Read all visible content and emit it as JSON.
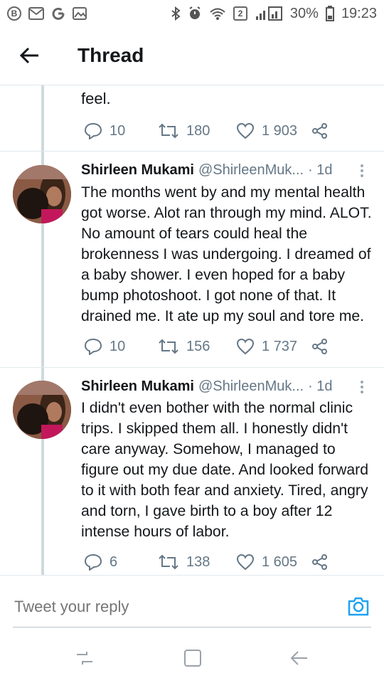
{
  "status_bar": {
    "left_icons": [
      "b-icon",
      "gmail-icon",
      "google-icon",
      "gallery-icon"
    ],
    "b_label": "B",
    "sim_slot": "2",
    "battery": "30%",
    "time": "19:23"
  },
  "header": {
    "title": "Thread"
  },
  "previous_tweet": {
    "text_fragment": "feel.",
    "replies": "10",
    "retweets": "180",
    "likes": "1 903"
  },
  "tweets": [
    {
      "name": "Shirleen Mukami",
      "handle": "@ShirleenMuk...",
      "time": "· 1d",
      "text": "The months went by and my mental health got worse. Alot ran through my mind. ALOT. No amount of tears could heal the brokenness I was undergoing. I dreamed of a baby shower. I even hoped for a baby bump photoshoot. I got none of that. It drained me. It ate up my soul and tore me.",
      "replies": "10",
      "retweets": "156",
      "likes": "1 737"
    },
    {
      "name": "Shirleen Mukami",
      "handle": "@ShirleenMuk...",
      "time": "· 1d",
      "text": "I didn't even bother with the normal clinic trips. I skipped them all. I honestly didn't care anyway. Somehow, I managed to figure out my due date. And looked forward to it with both fear and anxiety. Tired, angry and torn, I gave birth to a boy after 12 intense hours of labor.",
      "replies": "6",
      "retweets": "138",
      "likes": "1 605"
    }
  ],
  "reply": {
    "placeholder": "Tweet your reply"
  },
  "colors": {
    "accent": "#1da1f2",
    "muted": "#657786",
    "text": "#14171a",
    "divider": "#e1e8ed"
  }
}
